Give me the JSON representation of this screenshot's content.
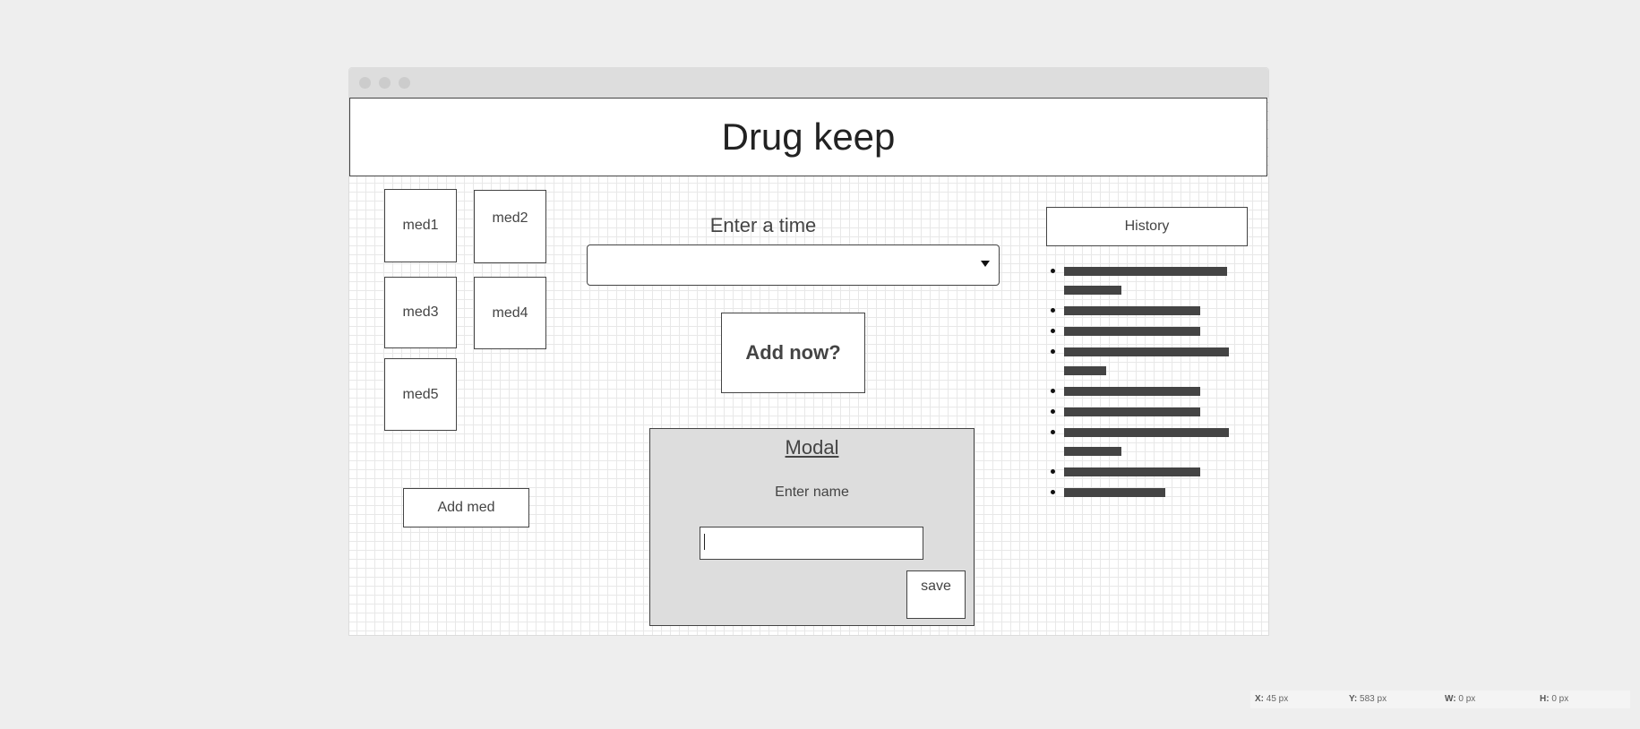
{
  "app": {
    "title": "Drug keep"
  },
  "meds": [
    {
      "label": "med1"
    },
    {
      "label": "med2"
    },
    {
      "label": "med3"
    },
    {
      "label": "med4"
    },
    {
      "label": "med5"
    }
  ],
  "add_med_button": "Add med",
  "time_entry": {
    "label": "Enter a time",
    "selected_value": ""
  },
  "add_now_button": "Add now?",
  "modal": {
    "title": "Modal",
    "name_label": "Enter name",
    "name_value": "",
    "save_button": "save"
  },
  "history": {
    "button_label": "History",
    "items": [
      {
        "lines": [
          0.85,
          0.3
        ]
      },
      {
        "lines": [
          0.71
        ]
      },
      {
        "lines": [
          0.71
        ]
      },
      {
        "lines": [
          0.86,
          0.22
        ]
      },
      {
        "lines": [
          0.71
        ]
      },
      {
        "lines": [
          0.71
        ]
      },
      {
        "lines": [
          0.86,
          0.3
        ]
      },
      {
        "lines": [
          0.71
        ]
      },
      {
        "lines": [
          0.53
        ]
      }
    ]
  },
  "status_bar": {
    "x_label": "X:",
    "x_value": "45 px",
    "y_label": "Y:",
    "y_value": "583 px",
    "w_label": "W:",
    "w_value": "0 px",
    "h_label": "H:",
    "h_value": "0 px"
  },
  "colors": {
    "background": "#eeeeee",
    "border": "#444444",
    "modal_fill": "#dddddd",
    "placeholder_bar": "#444444"
  }
}
